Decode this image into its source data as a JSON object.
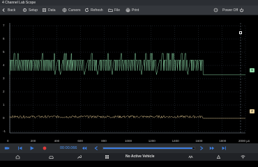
{
  "window": {
    "title": "4 Channel Lab Scope"
  },
  "toolbar": {
    "back": "Back",
    "setup": "Setup",
    "data": "Data",
    "cursors": "Cursors",
    "refresh": "Refresh",
    "file": "File",
    "print": "Print",
    "power_off": "Power Off"
  },
  "plot": {
    "y_labels": [
      "7",
      "6",
      "5",
      "4",
      "3",
      "2",
      "1",
      "0",
      "-1"
    ],
    "x_labels": [
      "0",
      "200",
      "400",
      "600",
      "800",
      "1000",
      "1200",
      "1400",
      "1600",
      "1800",
      "2000 µs"
    ],
    "channel_markers": [
      {
        "label": "1",
        "color": "#8fd9a8"
      },
      {
        "label": "2",
        "color": "#e8d29a"
      }
    ],
    "colors": {
      "trace1": "#86cfa0",
      "trace2": "#e0c690",
      "grid": "#2f3a45",
      "axis": "#9aa4ae"
    }
  },
  "playback": {
    "time": "00:00.066",
    "scroll_fraction": 0.98
  },
  "status": {
    "vehicle": "No Active Vehicle"
  }
}
